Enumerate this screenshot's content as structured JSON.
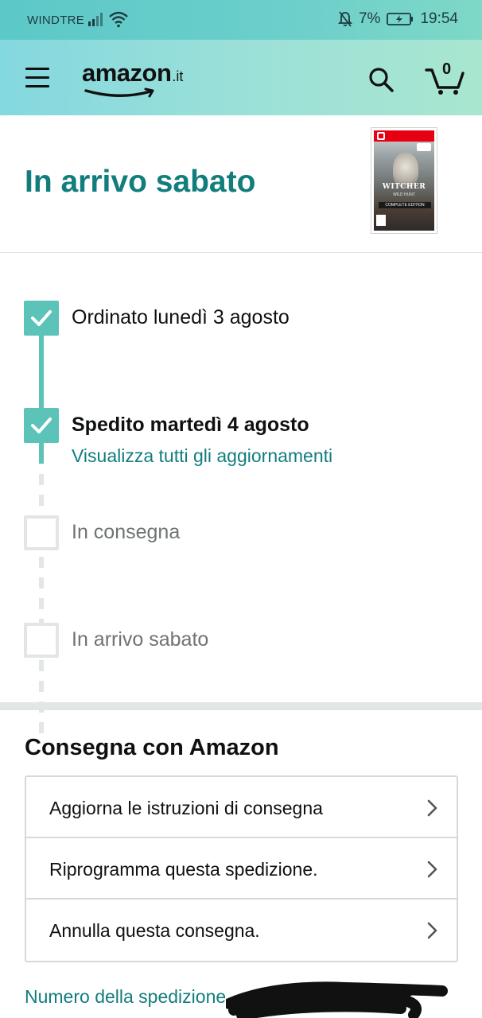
{
  "status_bar": {
    "carrier": "WINDTRE",
    "battery": "7%",
    "time": "19:54",
    "icons": [
      "signal-icon",
      "wifi-icon",
      "bell-off-icon",
      "battery-charging-icon"
    ]
  },
  "header": {
    "logo_text": "amazon",
    "logo_suffix": ".it",
    "cart_count": "0",
    "icons": [
      "menu-icon",
      "search-icon",
      "cart-icon"
    ]
  },
  "arrival": {
    "title": "In arrivo sabato",
    "product": {
      "cover_title": "WITCHER",
      "cover_subtitle": "WILD HUNT",
      "cover_band": "COMPLETE EDITION"
    }
  },
  "timeline": {
    "steps": [
      {
        "label": "Ordinato lunedì 3 agosto",
        "done": true
      },
      {
        "label": "Spedito martedì 4 agosto",
        "done": true
      },
      {
        "label": "In consegna",
        "done": false
      },
      {
        "label": "In arrivo sabato",
        "done": false
      }
    ],
    "updates_link": "Visualizza tutti gli aggiornamenti"
  },
  "delivery": {
    "title": "Consegna con Amazon",
    "options": [
      {
        "label": "Aggiorna le istruzioni di consegna"
      },
      {
        "label": "Riprogramma questa spedizione."
      },
      {
        "label": "Annulla questa consegna."
      }
    ],
    "tracking_label": "Numero della spedizione"
  },
  "colors": {
    "accent_teal": "#127d7d",
    "step_done": "#5cc3b8",
    "step_pending": "#e3e6e6",
    "header_gradient_start": "#84d8df",
    "header_gradient_end": "#a8e6cf"
  }
}
